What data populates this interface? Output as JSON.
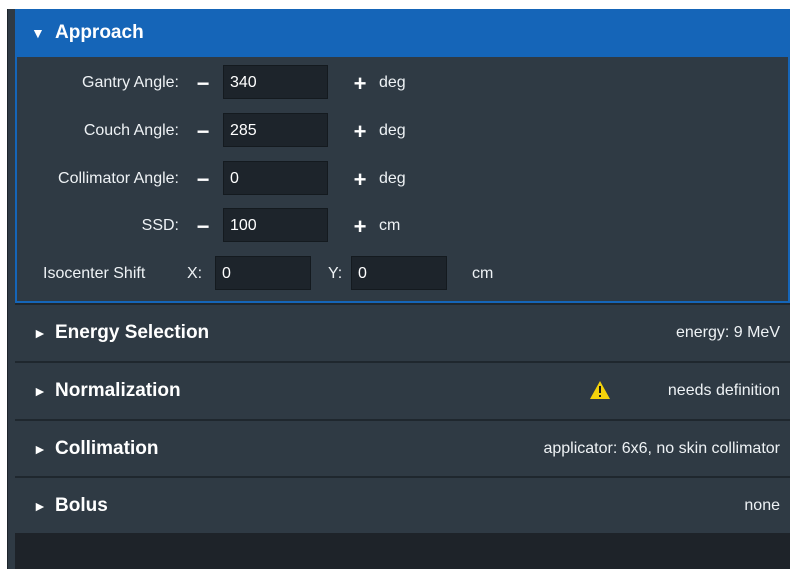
{
  "approach": {
    "title": "Approach",
    "gantry": {
      "label": "Gantry Angle:",
      "value": "340",
      "unit": "deg"
    },
    "couch": {
      "label": "Couch Angle:",
      "value": "285",
      "unit": "deg"
    },
    "collimator": {
      "label": "Collimator Angle:",
      "value": "0",
      "unit": "deg"
    },
    "ssd": {
      "label": "SSD:",
      "value": "100",
      "unit": "cm"
    },
    "iso": {
      "label": "Isocenter Shift",
      "x_label": "X:",
      "x_value": "0",
      "y_label": "Y:",
      "y_value": "0",
      "unit": "cm"
    },
    "minus_symbol": "−",
    "plus_symbol": "+"
  },
  "sections": {
    "energy": {
      "title": "Energy Selection",
      "summary": "energy: 9 MeV"
    },
    "normalization": {
      "title": "Normalization",
      "summary": "needs definition"
    },
    "collimation": {
      "title": "Collimation",
      "summary": "applicator: 6x6, no skin collimator"
    },
    "bolus": {
      "title": "Bolus",
      "summary": "none"
    }
  },
  "glyphs": {
    "expanded": "▼",
    "collapsed": "►"
  },
  "colors": {
    "accent": "#1565b8",
    "panel": "#2f3a44",
    "warning": "#f3d20b"
  },
  "icons": {
    "warning": "warning-icon"
  }
}
